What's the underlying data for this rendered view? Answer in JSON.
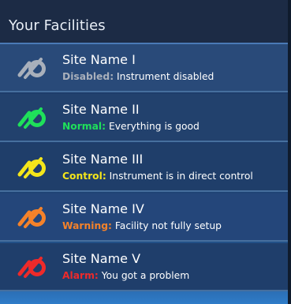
{
  "header": {
    "title": "Your Facilities"
  },
  "facilities": [
    {
      "name": "Site Name I",
      "status_word": "Disabled:",
      "status_text": " Instrument disabled",
      "color": "#a9b0bb",
      "icon": "disabled-status-icon"
    },
    {
      "name": "Site Name II",
      "status_word": "Normal:",
      "status_text": " Everything is good",
      "color": "#1fe05a",
      "icon": "normal-status-icon"
    },
    {
      "name": "Site Name III",
      "status_word": "Control:",
      "status_text": " Instrument is in direct control",
      "color": "#f4e61b",
      "icon": "control-status-icon"
    },
    {
      "name": "Site Name IV",
      "status_word": "Warning:",
      "status_text": " Facility not fully setup",
      "color": "#f4822a",
      "icon": "warning-status-icon"
    },
    {
      "name": "Site Name V",
      "status_word": "Alarm:",
      "status_text": " You got a problem",
      "color": "#ee2a2a",
      "icon": "alarm-status-icon"
    }
  ]
}
